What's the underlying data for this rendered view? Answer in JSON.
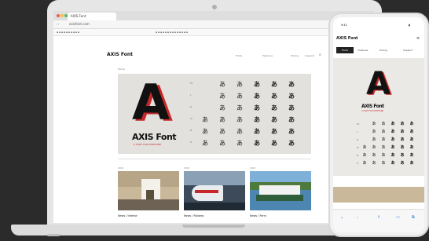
{
  "browser": {
    "tab_title": "AXIS Font",
    "url": "axisfont.com"
  },
  "site": {
    "logo": "AXIS Font",
    "nav": [
      "Fonts",
      "Features",
      "Pricing",
      "Support"
    ],
    "crumb": "Home",
    "hero": {
      "letter": "A",
      "name": "AXIS Font",
      "tagline": "A FONT FOR EVERYONE",
      "glyph": "あ"
    },
    "weights": [
      "UL",
      "EL",
      "L",
      "R",
      "M",
      "B",
      "H"
    ],
    "news": [
      {
        "caption": "News / Interior",
        "meta": "2019"
      },
      {
        "caption": "News / Railway",
        "meta": "2019"
      },
      {
        "caption": "News / Ferry",
        "meta": "2019"
      }
    ]
  },
  "phone": {
    "logo": "AXIS Font",
    "tabs": [
      "Fonts",
      "Features",
      "Pricing",
      "Support"
    ],
    "tagline": "A FONT FOR EVERYONE"
  }
}
